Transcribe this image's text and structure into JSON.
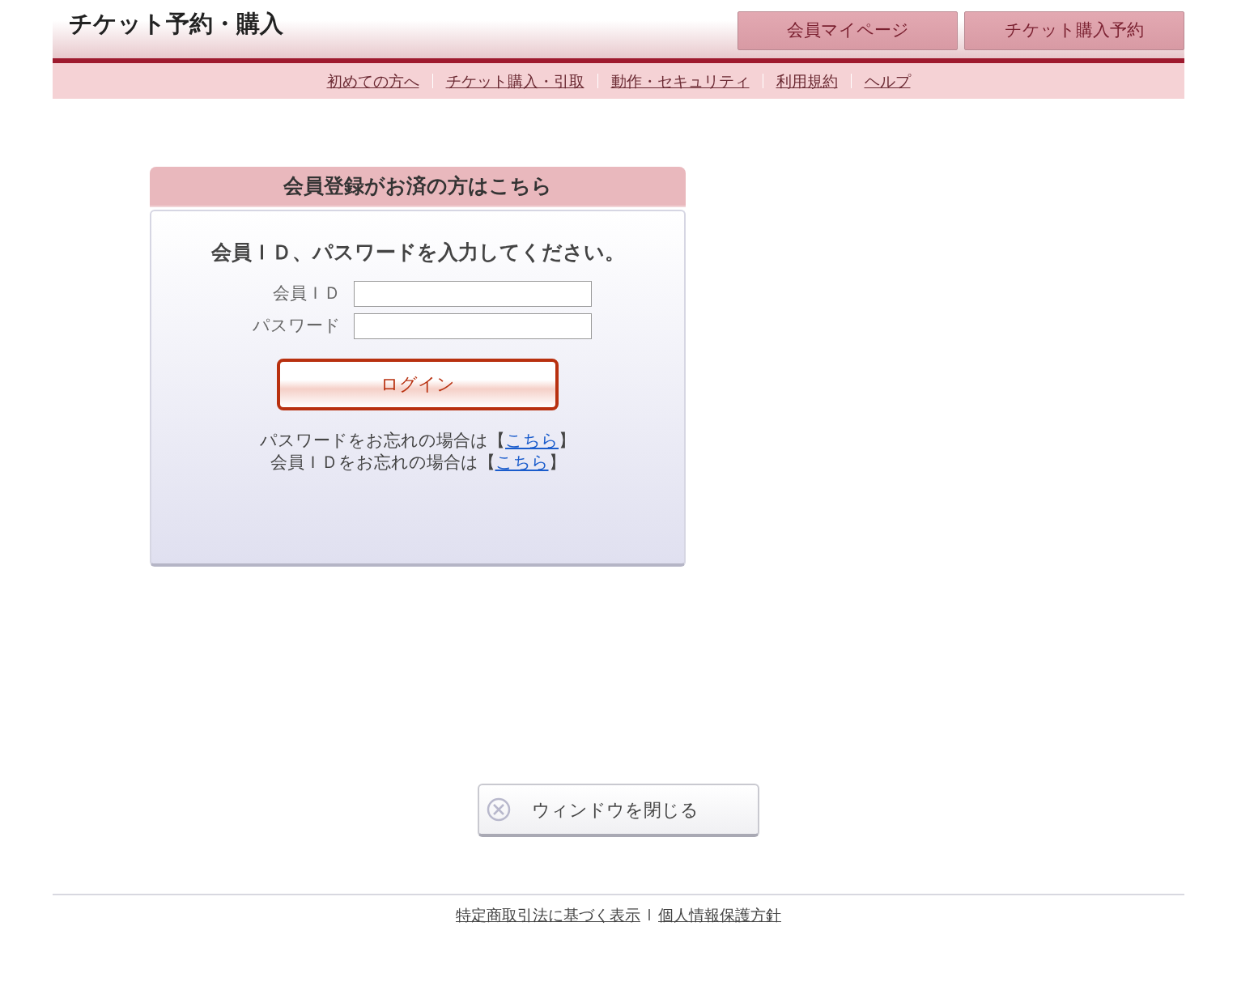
{
  "header": {
    "title": "チケット予約・購入",
    "buttons": [
      "会員マイページ",
      "チケット購入予約"
    ]
  },
  "nav": [
    "初めての方へ",
    "チケット購入・引取",
    "動作・セキュリティ",
    "利用規約",
    "ヘルプ"
  ],
  "login": {
    "heading": "会員登録がお済の方はこちら",
    "instruction": "会員ＩＤ、パスワードを入力してください。",
    "fields": [
      {
        "label": "会員ＩＤ"
      },
      {
        "label": "パスワード"
      }
    ],
    "button": "ログイン",
    "help": [
      {
        "before": "パスワードをお忘れの場合は【",
        "link": "こちら",
        "after": "】"
      },
      {
        "before": "会員ＩＤをお忘れの場合は【",
        "link": "こちら",
        "after": "】"
      }
    ]
  },
  "close_button": "ウィンドウを閉じる",
  "footer": [
    "特定商取引法に基づく表示",
    "個人情報保護方針"
  ]
}
